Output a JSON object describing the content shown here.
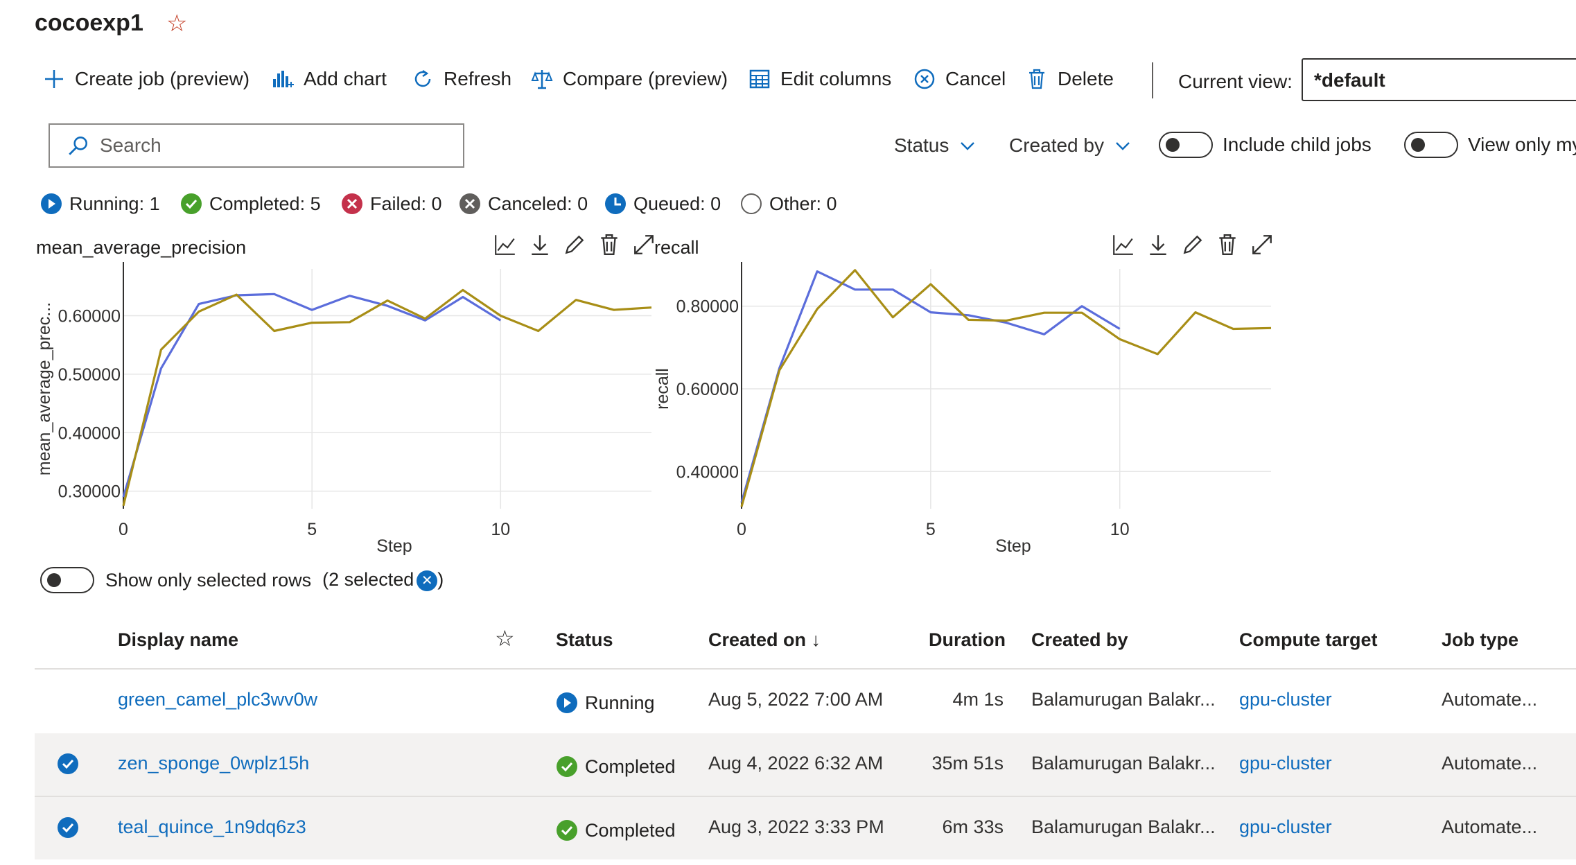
{
  "header": {
    "title": "cocoexp1"
  },
  "toolbar": {
    "create_job": "Create job (preview)",
    "add_chart": "Add chart",
    "refresh": "Refresh",
    "compare": "Compare (preview)",
    "edit_columns": "Edit columns",
    "cancel": "Cancel",
    "delete": "Delete",
    "current_view_label": "Current view:",
    "current_view_value": "*default"
  },
  "filters": {
    "search_placeholder": "Search",
    "status": "Status",
    "created_by": "Created by",
    "include_child_jobs": "Include child jobs",
    "view_only_mine": "View only my"
  },
  "status_counts": {
    "running": "Running: 1",
    "completed": "Completed: 5",
    "failed": "Failed: 0",
    "canceled": "Canceled: 0",
    "queued": "Queued: 0",
    "other": "Other: 0"
  },
  "colors": {
    "series_blue": "#5b6ddb",
    "series_gold": "#a88e16",
    "accent": "#0f6cbd",
    "success": "#48a02b",
    "danger": "#c4314b"
  },
  "chart_data": [
    {
      "type": "line",
      "title": "mean_average_precision",
      "xlabel": "Step",
      "ylabel": "mean_average_prec...",
      "xlim": [
        0,
        14
      ],
      "ylim": [
        0.27,
        0.68
      ],
      "xticks": [
        "0",
        "5",
        "10"
      ],
      "yticks": [
        "0.30000",
        "0.40000",
        "0.50000",
        "0.60000"
      ],
      "series": [
        {
          "color": "#5b6ddb",
          "x": [
            0,
            1,
            2,
            3,
            4,
            5,
            6,
            7,
            8,
            9,
            10
          ],
          "y": [
            0.29,
            0.51,
            0.62,
            0.635,
            0.637,
            0.61,
            0.634,
            0.617,
            0.592,
            0.632,
            0.592
          ]
        },
        {
          "color": "#a88e16",
          "x": [
            0,
            1,
            2,
            3,
            4,
            5,
            6,
            7,
            8,
            9,
            10,
            11,
            12,
            13,
            14
          ],
          "y": [
            0.275,
            0.542,
            0.607,
            0.636,
            0.574,
            0.588,
            0.589,
            0.626,
            0.595,
            0.644,
            0.6,
            0.574,
            0.627,
            0.61,
            0.614
          ]
        }
      ]
    },
    {
      "type": "line",
      "title": "recall",
      "xlabel": "Step",
      "ylabel": "recall",
      "xlim": [
        0,
        14
      ],
      "ylim": [
        0.31,
        0.89
      ],
      "xticks": [
        "0",
        "5",
        "10"
      ],
      "yticks": [
        "0.40000",
        "0.60000",
        "0.80000"
      ],
      "series": [
        {
          "color": "#5b6ddb",
          "x": [
            0,
            1,
            2,
            3,
            4,
            5,
            6,
            7,
            8,
            9,
            10
          ],
          "y": [
            0.325,
            0.65,
            0.884,
            0.84,
            0.84,
            0.785,
            0.778,
            0.76,
            0.732,
            0.8,
            0.745
          ]
        },
        {
          "color": "#a88e16",
          "x": [
            0,
            1,
            2,
            3,
            4,
            5,
            6,
            7,
            8,
            9,
            10,
            11,
            12,
            13,
            14
          ],
          "y": [
            0.315,
            0.645,
            0.793,
            0.887,
            0.773,
            0.853,
            0.767,
            0.765,
            0.784,
            0.784,
            0.72,
            0.684,
            0.785,
            0.745,
            0.747
          ]
        }
      ]
    }
  ],
  "selection": {
    "label": "Show only selected rows",
    "count": "(2 selected",
    "close": ")"
  },
  "table": {
    "headers": {
      "display_name": "Display name",
      "status": "Status",
      "created_on": "Created on ↓",
      "duration": "Duration",
      "created_by": "Created by",
      "compute_target": "Compute target",
      "job_type": "Job type"
    },
    "rows": [
      {
        "name": "green_camel_plc3wv0w",
        "status": "Running",
        "created_on": "Aug 5, 2022 7:00 AM",
        "duration": "4m 1s",
        "created_by": "Balamurugan Balakr...",
        "compute": "gpu-cluster",
        "job_type": "Automate..."
      },
      {
        "name": "zen_sponge_0wplz15h",
        "status": "Completed",
        "created_on": "Aug 4, 2022 6:32 AM",
        "duration": "35m 51s",
        "created_by": "Balamurugan Balakr...",
        "compute": "gpu-cluster",
        "job_type": "Automate..."
      },
      {
        "name": "teal_quince_1n9dq6z3",
        "status": "Completed",
        "created_on": "Aug 3, 2022 3:33 PM",
        "duration": "6m 33s",
        "created_by": "Balamurugan Balakr...",
        "compute": "gpu-cluster",
        "job_type": "Automate..."
      }
    ]
  }
}
